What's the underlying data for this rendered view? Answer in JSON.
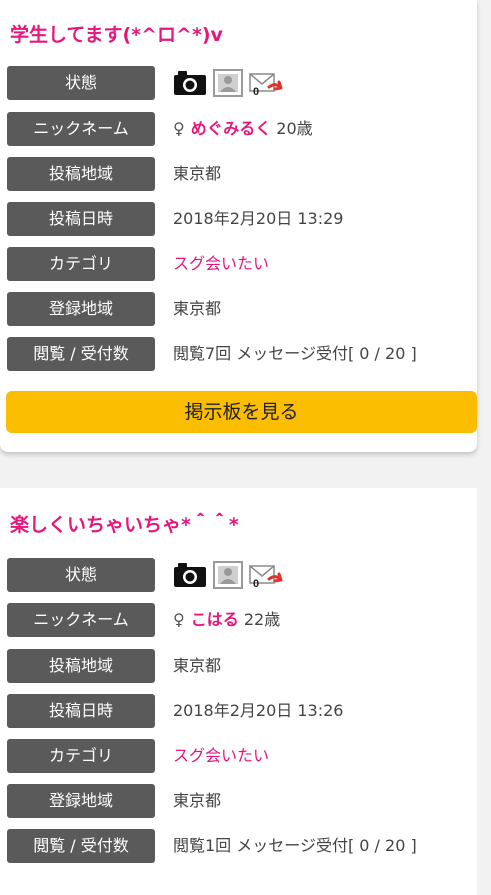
{
  "icons": {
    "camera": "camera-icon",
    "photo": "profile-photo-icon",
    "mail": "mail-reply-icon"
  },
  "colors": {
    "accent": "#e6177c",
    "button": "#fbbd00",
    "label_bg": "#5a5a5a"
  },
  "posts": [
    {
      "title": "学生してます(*^ロ^*)v",
      "rows": [
        {
          "label": "状態"
        },
        {
          "label": "ニックネーム",
          "gender": "♀",
          "name": "めぐみるく",
          "age": "20歳"
        },
        {
          "label": "投稿地域",
          "value": "東京都"
        },
        {
          "label": "投稿日時",
          "value": "2018年2月20日 13:29"
        },
        {
          "label": "カテゴリ",
          "value": "スグ会いたい"
        },
        {
          "label": "登録地域",
          "value": "東京都"
        },
        {
          "label": "閲覧 / 受付数",
          "value": "閲覧7回 メッセージ受付[ 0 / 20 ]"
        }
      ],
      "mail_count": "0",
      "button": "掲示板を見る"
    },
    {
      "title": "楽しくいちゃいちゃ*＾＾*",
      "rows": [
        {
          "label": "状態"
        },
        {
          "label": "ニックネーム",
          "gender": "♀",
          "name": "こはる",
          "age": "22歳"
        },
        {
          "label": "投稿地域",
          "value": "東京都"
        },
        {
          "label": "投稿日時",
          "value": "2018年2月20日 13:26"
        },
        {
          "label": "カテゴリ",
          "value": "スグ会いたい"
        },
        {
          "label": "登録地域",
          "value": "東京都"
        },
        {
          "label": "閲覧 / 受付数",
          "value": "閲覧1回 メッセージ受付[ 0 / 20 ]"
        }
      ],
      "mail_count": "0"
    }
  ]
}
